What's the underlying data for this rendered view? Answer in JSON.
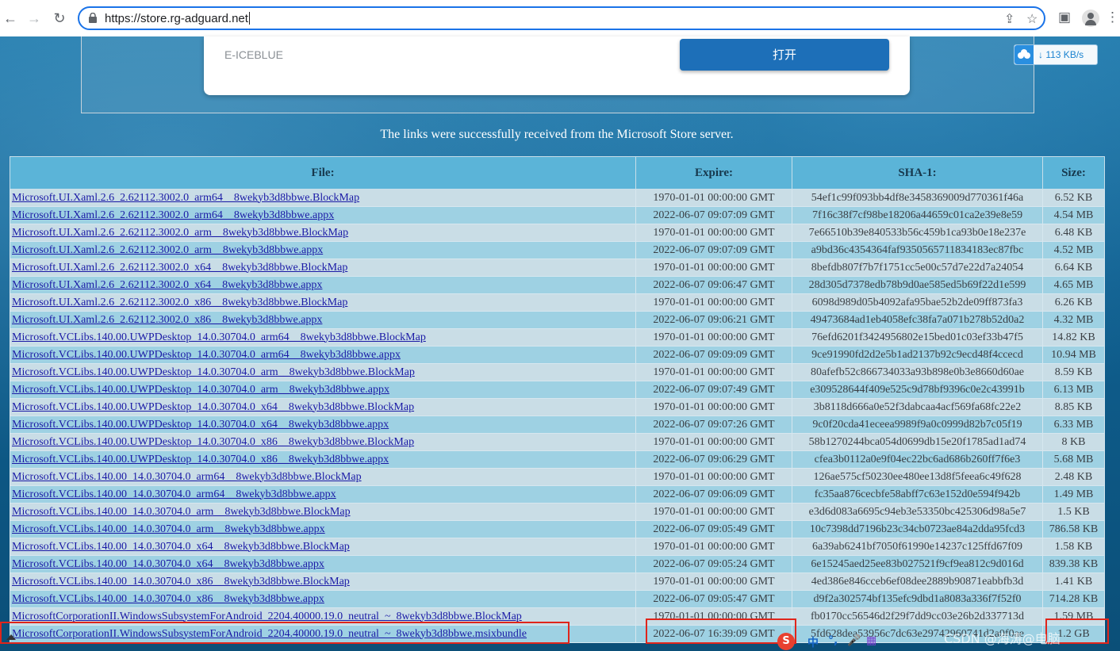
{
  "browser": {
    "url": "https://store.rg-adguard.net"
  },
  "ad": {
    "brand": "E-ICEBLUE",
    "button_label": "打开"
  },
  "speed_indicator": "113 KB/s",
  "status_message": "The links were successfully received from the Microsoft Store server.",
  "table": {
    "headers": [
      "File:",
      "Expire:",
      "SHA-1:",
      "Size:"
    ],
    "rows": [
      {
        "file": "Microsoft.UI.Xaml.2.6_2.62112.3002.0_arm64__8wekyb3d8bbwe.BlockMap",
        "expire": "1970-01-01 00:00:00 GMT",
        "sha1": "54ef1c99f093bb4df8e3458369009d770361f46a",
        "size": "6.52 KB"
      },
      {
        "file": "Microsoft.UI.Xaml.2.6_2.62112.3002.0_arm64__8wekyb3d8bbwe.appx",
        "expire": "2022-06-07 09:07:09 GMT",
        "sha1": "7f16c38f7cf98be18206a44659c01ca2e39e8e59",
        "size": "4.54 MB"
      },
      {
        "file": "Microsoft.UI.Xaml.2.6_2.62112.3002.0_arm__8wekyb3d8bbwe.BlockMap",
        "expire": "1970-01-01 00:00:00 GMT",
        "sha1": "7e66510b39e840533b56c459b1ca93b0e18e237e",
        "size": "6.48 KB"
      },
      {
        "file": "Microsoft.UI.Xaml.2.6_2.62112.3002.0_arm__8wekyb3d8bbwe.appx",
        "expire": "2022-06-07 09:07:09 GMT",
        "sha1": "a9bd36c4354364faf9350565711834183ec87fbc",
        "size": "4.52 MB"
      },
      {
        "file": "Microsoft.UI.Xaml.2.6_2.62112.3002.0_x64__8wekyb3d8bbwe.BlockMap",
        "expire": "1970-01-01 00:00:00 GMT",
        "sha1": "8befdb807f7b7f1751cc5e00c57d7e22d7a24054",
        "size": "6.64 KB"
      },
      {
        "file": "Microsoft.UI.Xaml.2.6_2.62112.3002.0_x64__8wekyb3d8bbwe.appx",
        "expire": "2022-06-07 09:06:47 GMT",
        "sha1": "28d305d7378edb78b9d0ae585ed5b69f22d1e599",
        "size": "4.65 MB"
      },
      {
        "file": "Microsoft.UI.Xaml.2.6_2.62112.3002.0_x86__8wekyb3d8bbwe.BlockMap",
        "expire": "1970-01-01 00:00:00 GMT",
        "sha1": "6098d989d05b4092afa95bae52b2de09ff873fa3",
        "size": "6.26 KB"
      },
      {
        "file": "Microsoft.UI.Xaml.2.6_2.62112.3002.0_x86__8wekyb3d8bbwe.appx",
        "expire": "2022-06-07 09:06:21 GMT",
        "sha1": "49473684ad1eb4058efc38fa7a071b278b52d0a2",
        "size": "4.32 MB"
      },
      {
        "file": "Microsoft.VCLibs.140.00.UWPDesktop_14.0.30704.0_arm64__8wekyb3d8bbwe.BlockMap",
        "expire": "1970-01-01 00:00:00 GMT",
        "sha1": "76efd6201f3424956802e15bed01c03ef33b47f5",
        "size": "14.82 KB"
      },
      {
        "file": "Microsoft.VCLibs.140.00.UWPDesktop_14.0.30704.0_arm64__8wekyb3d8bbwe.appx",
        "expire": "2022-06-07 09:09:09 GMT",
        "sha1": "9ce91990fd2d2e5b1ad2137b92c9ecd48f4ccecd",
        "size": "10.94 MB"
      },
      {
        "file": "Microsoft.VCLibs.140.00.UWPDesktop_14.0.30704.0_arm__8wekyb3d8bbwe.BlockMap",
        "expire": "1970-01-01 00:00:00 GMT",
        "sha1": "80afefb52c866734033a93b898e0b3e8660d60ae",
        "size": "8.59 KB"
      },
      {
        "file": "Microsoft.VCLibs.140.00.UWPDesktop_14.0.30704.0_arm__8wekyb3d8bbwe.appx",
        "expire": "2022-06-07 09:07:49 GMT",
        "sha1": "e309528644f409e525c9d78bf9396c0e2c43991b",
        "size": "6.13 MB"
      },
      {
        "file": "Microsoft.VCLibs.140.00.UWPDesktop_14.0.30704.0_x64__8wekyb3d8bbwe.BlockMap",
        "expire": "1970-01-01 00:00:00 GMT",
        "sha1": "3b8118d666a0e52f3dabcaa4acf569fa68fc22e2",
        "size": "8.85 KB"
      },
      {
        "file": "Microsoft.VCLibs.140.00.UWPDesktop_14.0.30704.0_x64__8wekyb3d8bbwe.appx",
        "expire": "2022-06-07 09:07:26 GMT",
        "sha1": "9c0f20cda41eceea9989f9a0c0999d82b7c05f19",
        "size": "6.33 MB"
      },
      {
        "file": "Microsoft.VCLibs.140.00.UWPDesktop_14.0.30704.0_x86__8wekyb3d8bbwe.BlockMap",
        "expire": "1970-01-01 00:00:00 GMT",
        "sha1": "58b1270244bca054d0699db15e20f1785ad1ad74",
        "size": "8 KB"
      },
      {
        "file": "Microsoft.VCLibs.140.00.UWPDesktop_14.0.30704.0_x86__8wekyb3d8bbwe.appx",
        "expire": "2022-06-07 09:06:29 GMT",
        "sha1": "cfea3b0112a0e9f04ec22bc6ad686b260ff7f6e3",
        "size": "5.68 MB"
      },
      {
        "file": "Microsoft.VCLibs.140.00_14.0.30704.0_arm64__8wekyb3d8bbwe.BlockMap",
        "expire": "1970-01-01 00:00:00 GMT",
        "sha1": "126ae575cf50230ee480ee13d8f5feea6c49f628",
        "size": "2.48 KB"
      },
      {
        "file": "Microsoft.VCLibs.140.00_14.0.30704.0_arm64__8wekyb3d8bbwe.appx",
        "expire": "2022-06-07 09:06:09 GMT",
        "sha1": "fc35aa876cecbfe58abff7c63e152d0e594f942b",
        "size": "1.49 MB"
      },
      {
        "file": "Microsoft.VCLibs.140.00_14.0.30704.0_arm__8wekyb3d8bbwe.BlockMap",
        "expire": "1970-01-01 00:00:00 GMT",
        "sha1": "e3d6d083a6695c94eb3e53350bc425306d98a5e7",
        "size": "1.5 KB"
      },
      {
        "file": "Microsoft.VCLibs.140.00_14.0.30704.0_arm__8wekyb3d8bbwe.appx",
        "expire": "2022-06-07 09:05:49 GMT",
        "sha1": "10c7398dd7196b23c34cb0723ae84a2dda95fcd3",
        "size": "786.58 KB"
      },
      {
        "file": "Microsoft.VCLibs.140.00_14.0.30704.0_x64__8wekyb3d8bbwe.BlockMap",
        "expire": "1970-01-01 00:00:00 GMT",
        "sha1": "6a39ab6241bf7050f61990e14237c125ffd67f09",
        "size": "1.58 KB"
      },
      {
        "file": "Microsoft.VCLibs.140.00_14.0.30704.0_x64__8wekyb3d8bbwe.appx",
        "expire": "2022-06-07 09:05:24 GMT",
        "sha1": "6e15245aed25ee83b027521f9cf9ea812c9d016d",
        "size": "839.38 KB"
      },
      {
        "file": "Microsoft.VCLibs.140.00_14.0.30704.0_x86__8wekyb3d8bbwe.BlockMap",
        "expire": "1970-01-01 00:00:00 GMT",
        "sha1": "4ed386e846cceb6ef08dee2889b90871eabbfb3d",
        "size": "1.41 KB"
      },
      {
        "file": "Microsoft.VCLibs.140.00_14.0.30704.0_x86__8wekyb3d8bbwe.appx",
        "expire": "2022-06-07 09:05:47 GMT",
        "sha1": "d9f2a302574bf135efc9dbd1a8083a336f7f52f0",
        "size": "714.28 KB"
      },
      {
        "file": "MicrosoftCorporationII.WindowsSubsystemForAndroid_2204.40000.19.0_neutral_~_8wekyb3d8bbwe.BlockMap",
        "expire": "1970-01-01 00:00:00 GMT",
        "sha1": "fb0170cc56546d2f29f7dd9cc03e26b2d337713d",
        "size": "1.59 MB"
      },
      {
        "file": "MicrosoftCorporationII.WindowsSubsystemForAndroid_2204.40000.19.0_neutral_~_8wekyb3d8bbwe.msixbundle",
        "expire": "2022-06-07 16:39:09 GMT",
        "sha1": "5fd628dea53956c7dc63e29742960741d2a0f0ae",
        "size": "1.2 GB"
      }
    ]
  },
  "ime_toolbar": {
    "logo": "S",
    "mode": "中",
    "punct": "°,",
    "mic": "🎤",
    "grid": "▦"
  },
  "watermark": "CSDN @海涛@电脑",
  "colors": {
    "annotation": "#e0251b",
    "accent": "#1a73e8",
    "link": "#1a1aa6"
  }
}
